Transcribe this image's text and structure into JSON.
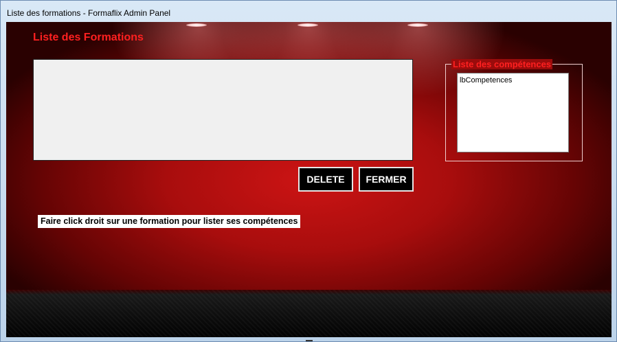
{
  "window": {
    "title": "Liste des formations - Formaflix Admin Panel"
  },
  "main": {
    "page_title": "Liste des Formations",
    "formations_list": {
      "items": []
    },
    "buttons": {
      "delete_label": "DELETE",
      "fermer_label": "FERMER"
    },
    "hint": "Faire click droit sur une formation pour lister ses compétences"
  },
  "competences": {
    "group_title": "Liste des compétences",
    "list_placeholder_item": "lbCompetences"
  },
  "colors": {
    "accent_red": "#ff2020",
    "button_bg": "#000000",
    "list_bg": "#f0f0f0"
  }
}
